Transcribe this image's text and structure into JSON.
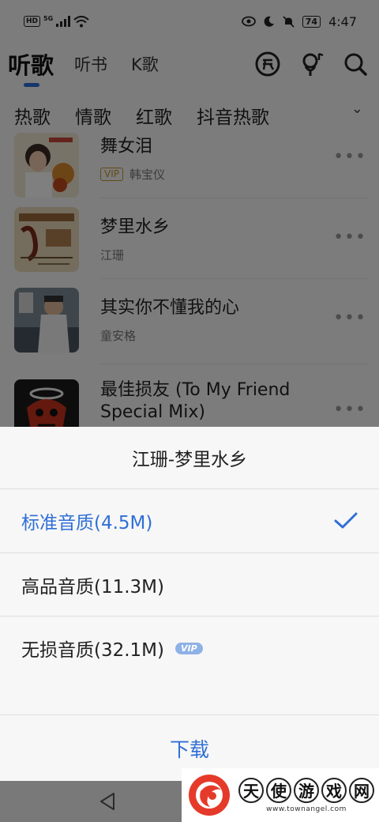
{
  "status_bar": {
    "network": "HD",
    "network_gen": "5G",
    "battery": "74",
    "time": "4:47"
  },
  "tabs": [
    "听歌",
    "听书",
    "K歌"
  ],
  "tab_icons": [
    "free-icon",
    "karaoke-mic-icon",
    "search-icon"
  ],
  "categories": [
    "热歌",
    "情歌",
    "红歌",
    "抖音热歌"
  ],
  "category_more": "⌄",
  "songs": [
    {
      "title": "舞女泪",
      "vip": "VIP",
      "artist": "韩宝仪"
    },
    {
      "title": "梦里水乡",
      "vip": "",
      "artist": "江珊"
    },
    {
      "title": "其实你不懂我的心",
      "vip": "",
      "artist": "童安格"
    },
    {
      "title": "最佳损友 (To My Friend Special Mix)",
      "vip": "",
      "artist": ""
    }
  ],
  "more_glyph": "•••",
  "sheet": {
    "title": "江珊-梦里水乡",
    "options": [
      {
        "label": "标准音质(4.5M)",
        "selected": true
      },
      {
        "label": "高品音质(11.3M)",
        "selected": false
      },
      {
        "label": "无损音质(32.1M)",
        "selected": false,
        "badge": "VIP"
      }
    ],
    "download_label": "下载"
  },
  "watermark": {
    "chars": [
      "天",
      "使",
      "游",
      "戏",
      "网"
    ],
    "url": "www.townangel.com"
  },
  "colors": {
    "accent": "#2f6fd6",
    "vip_gold": "#c9942b",
    "vip_badge": "#8fb2e6"
  }
}
